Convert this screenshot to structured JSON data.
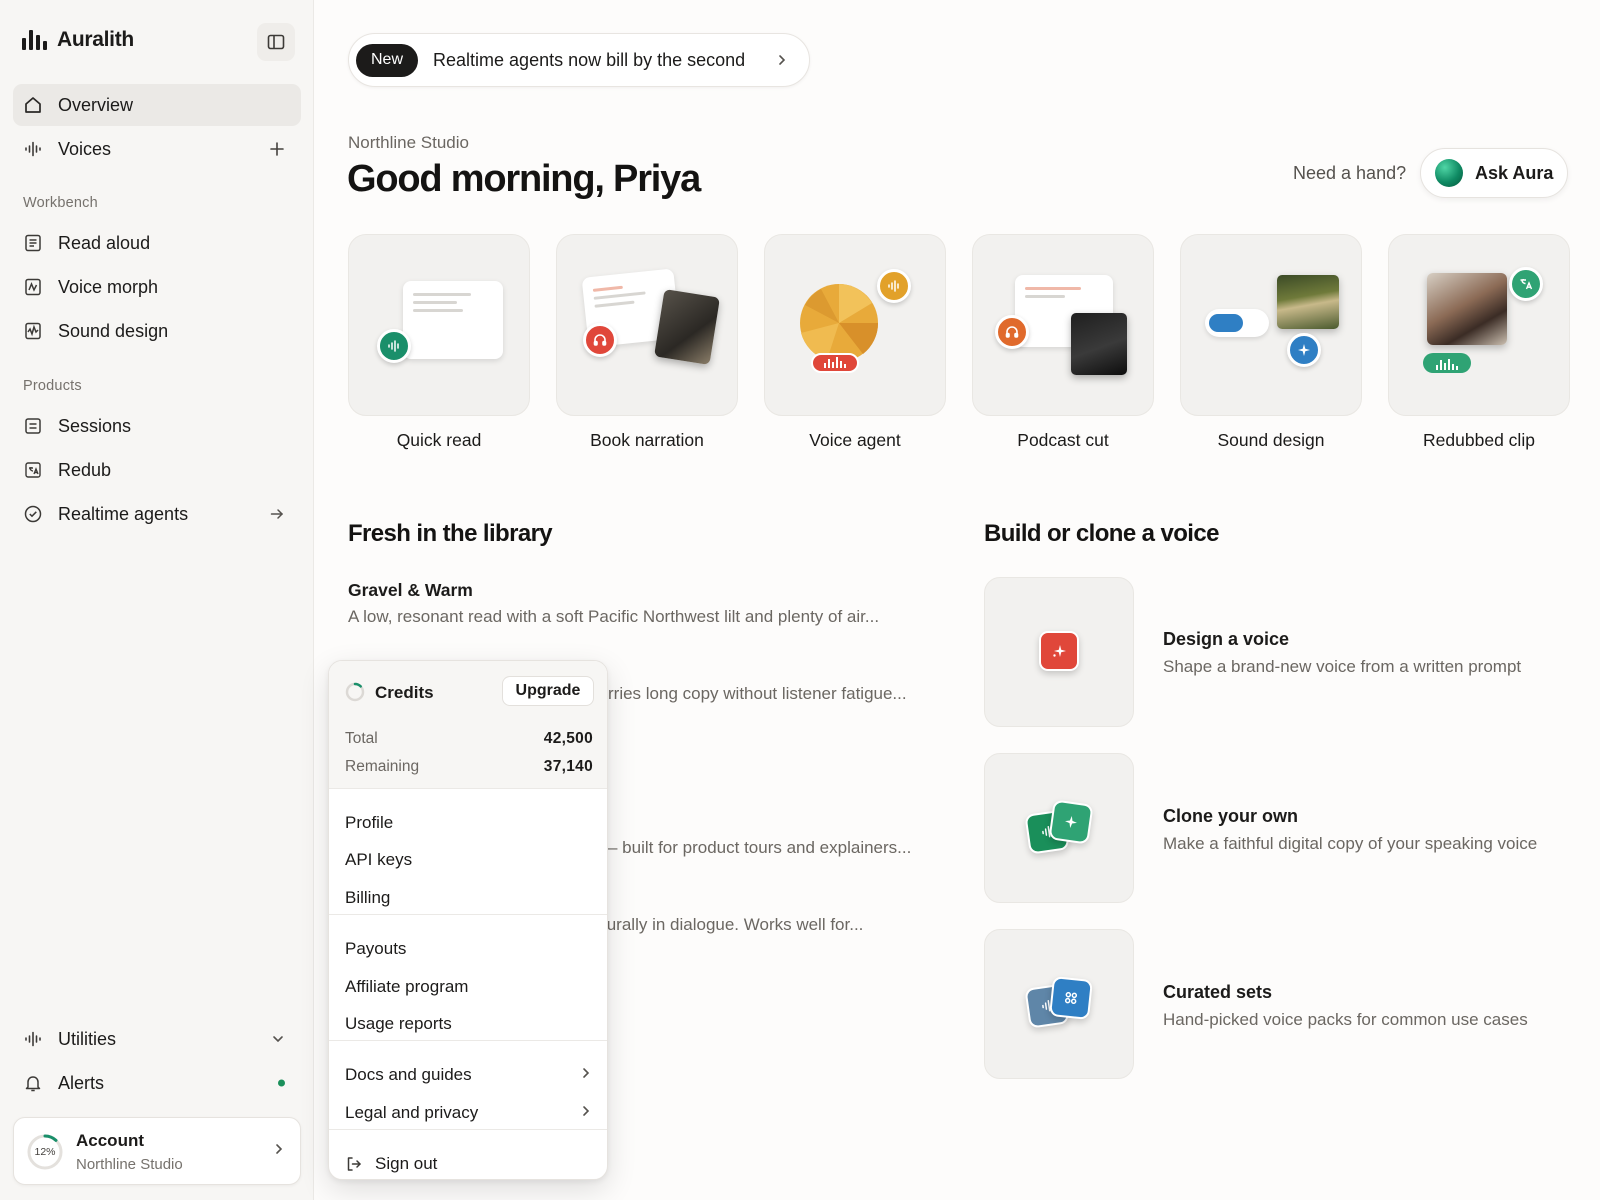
{
  "brand": {
    "name": "Auralith"
  },
  "sidebar": {
    "primary": [
      {
        "label": "Overview",
        "icon": "home-icon",
        "active": true
      },
      {
        "label": "Voices",
        "icon": "waveform-icon",
        "trail": "plus-icon"
      }
    ],
    "workbench_heading": "Workbench",
    "workbench": [
      {
        "label": "Read aloud",
        "icon": "document-icon"
      },
      {
        "label": "Voice morph",
        "icon": "morph-icon"
      },
      {
        "label": "Sound design",
        "icon": "wave-box-icon"
      }
    ],
    "products_heading": "Products",
    "products": [
      {
        "label": "Sessions",
        "icon": "list-box-icon"
      },
      {
        "label": "Redub",
        "icon": "translate-box-icon"
      },
      {
        "label": "Realtime agents",
        "icon": "check-circle-icon",
        "trail": "arrow-right-icon"
      }
    ],
    "bottom": [
      {
        "label": "Utilities",
        "icon": "waveform-icon",
        "trail": "chevron-down-icon"
      },
      {
        "label": "Alerts",
        "icon": "bell-icon",
        "trail": "status-dot"
      }
    ],
    "account": {
      "progress_label": "12%",
      "progress": 0.12,
      "title": "Account",
      "subtitle": "Northline Studio"
    }
  },
  "announcement": {
    "badge": "New",
    "text": "Realtime agents now bill by the second"
  },
  "header": {
    "studio": "Northline Studio",
    "greeting": "Good morning, Priya",
    "help_text": "Need a hand?",
    "assistant_button": "Ask Aura"
  },
  "quick_tiles": [
    {
      "label": "Quick read"
    },
    {
      "label": "Book narration"
    },
    {
      "label": "Voice agent"
    },
    {
      "label": "Podcast cut"
    },
    {
      "label": "Sound design"
    },
    {
      "label": "Redubbed clip"
    }
  ],
  "library": {
    "heading": "Fresh in the library",
    "items": [
      {
        "title": "Gravel & Warm",
        "description": "A low, resonant read with a soft Pacific Northwest lilt and plenty of air..."
      },
      {
        "description": "rries long copy without listener fatigue..."
      },
      {
        "description": "– built for product tours and explainers..."
      },
      {
        "description": "turally in dialogue. Works well for..."
      }
    ]
  },
  "build": {
    "heading": "Build or clone a voice",
    "items": [
      {
        "title": "Design a voice",
        "description": "Shape a brand-new voice from a written prompt"
      },
      {
        "title": "Clone your own",
        "description": "Make a faithful digital copy of your speaking voice"
      },
      {
        "title": "Curated sets",
        "description": "Hand-picked voice packs for common use cases"
      }
    ]
  },
  "menu": {
    "credits_label": "Credits",
    "upgrade_label": "Upgrade",
    "total_label": "Total",
    "total_value": "42,500",
    "remaining_label": "Remaining",
    "remaining_value": "37,140",
    "group1": [
      "Profile",
      "API keys",
      "Billing"
    ],
    "group2": [
      "Payouts",
      "Affiliate program",
      "Usage reports"
    ],
    "group3": [
      "Docs and guides",
      "Legal and privacy"
    ],
    "sign_out": "Sign out"
  },
  "colors": {
    "accent_teal": "#1a8f6a",
    "accent_orange": "#e06a2c",
    "accent_red": "#e0473a",
    "accent_amber": "#e2a12a",
    "accent_blue": "#2f7fc4",
    "accent_green": "#2fa374"
  }
}
